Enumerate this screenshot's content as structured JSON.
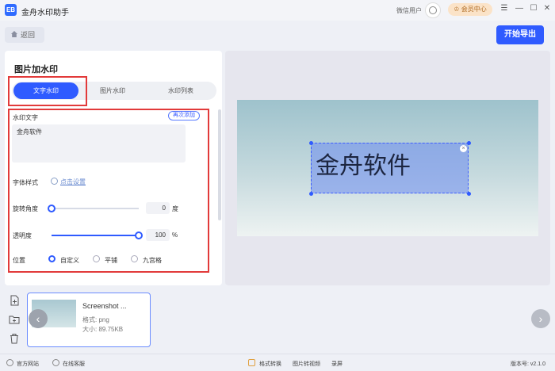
{
  "app": {
    "title": "金舟水印助手",
    "logo_text": "EB"
  },
  "titlebar": {
    "user_name": "微信用户",
    "vip_label": "会员中心",
    "controls": [
      "☰",
      "—",
      "☐",
      "✕"
    ]
  },
  "toolbar": {
    "back_label": "返回",
    "export_label": "开始导出"
  },
  "panel": {
    "title": "图片加水印",
    "tabs": [
      {
        "label": "文字水印",
        "active": true
      },
      {
        "label": "图片水印",
        "active": false
      },
      {
        "label": "水印列表",
        "active": false
      }
    ],
    "watermark_text_label": "水印文字",
    "readd_label": "再次添加",
    "watermark_text_value": "金舟软件",
    "font_style_label": "字体样式",
    "font_style_link": "点击设置",
    "rotation_label": "旋转角度",
    "rotation_value": "0",
    "rotation_unit": "度",
    "opacity_label": "透明度",
    "opacity_value": "100",
    "opacity_unit": "%",
    "position_label": "位置",
    "position_options": [
      {
        "label": "自定义",
        "selected": true
      },
      {
        "label": "平铺",
        "selected": false
      },
      {
        "label": "九宫格",
        "selected": false
      }
    ],
    "rotation_fraction": 0.0,
    "opacity_fraction": 1.0
  },
  "preview": {
    "watermark_text": "金舟软件"
  },
  "file": {
    "name": "Screenshot ...",
    "format": "格式: png",
    "size": "大小: 89.75KB"
  },
  "footer": {
    "website": "官方网站",
    "support": "在线客服",
    "format_convert": "格式转换",
    "img_to_video": "图片转视频",
    "screen_record": "录屏",
    "version": "版本号: v2.1.0"
  },
  "colors": {
    "accent": "#2f5bff",
    "highlight_box": "#e23a3a"
  }
}
